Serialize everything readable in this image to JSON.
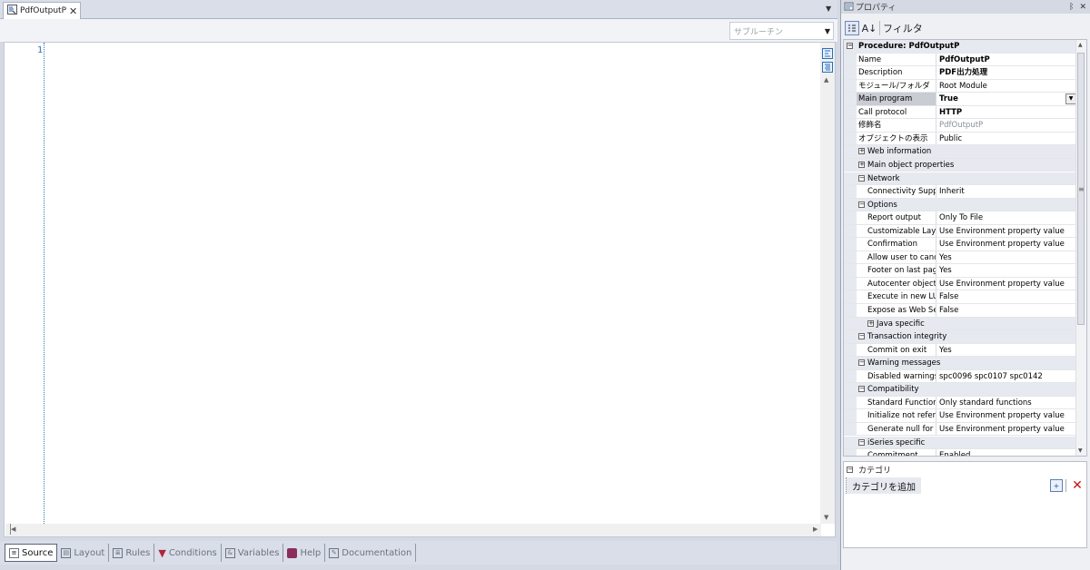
{
  "editor": {
    "tab_title": "PdfOutputP",
    "tab_close": "✕",
    "subroutine_placeholder": "サブルーチン",
    "line_numbers": [
      "1"
    ]
  },
  "part_tabs": [
    {
      "label": "Source",
      "icon": "source-icon",
      "active": true
    },
    {
      "label": "Layout",
      "icon": "layout-icon",
      "active": false
    },
    {
      "label": "Rules",
      "icon": "rules-icon",
      "active": false
    },
    {
      "label": "Conditions",
      "icon": "conditions-filter-icon",
      "active": false
    },
    {
      "label": "Variables",
      "icon": "variables-icon",
      "active": false
    },
    {
      "label": "Help",
      "icon": "help-book-icon",
      "active": false
    },
    {
      "label": "Documentation",
      "icon": "documentation-icon",
      "active": false
    }
  ],
  "properties": {
    "panel_title": "プロパティ",
    "filter_label": "フィルタ",
    "object_header": "Procedure: PdfOutputP",
    "rows": [
      {
        "kind": "prop",
        "name": "Name",
        "value": "PdfOutputP",
        "bold": true
      },
      {
        "kind": "prop",
        "name": "Description",
        "value": "PDF出力処理",
        "bold": true
      },
      {
        "kind": "prop",
        "name": "モジュール/フォルダ",
        "value": "Root Module"
      },
      {
        "kind": "prop",
        "name": "Main program",
        "value": "True",
        "bold": true,
        "selected": true,
        "dropdown": true
      },
      {
        "kind": "prop",
        "name": "Call protocol",
        "value": "HTTP",
        "bold": true
      },
      {
        "kind": "prop",
        "name": "修飾名",
        "value": "PdfOutputP",
        "gray": true
      },
      {
        "kind": "prop",
        "name": "オブジェクトの表示",
        "value": "Public"
      },
      {
        "kind": "cat",
        "name": "Web information",
        "expand": "+"
      },
      {
        "kind": "cat",
        "name": "Main object properties",
        "expand": "+"
      },
      {
        "kind": "cat",
        "name": "Network",
        "expand": "−"
      },
      {
        "kind": "sub",
        "name": "Connectivity Support",
        "value": "Inherit"
      },
      {
        "kind": "cat",
        "name": "Options",
        "expand": "−"
      },
      {
        "kind": "sub",
        "name": "Report output",
        "value": "Only To File"
      },
      {
        "kind": "sub",
        "name": "Customizable Layout",
        "value": "Use Environment property value"
      },
      {
        "kind": "sub",
        "name": "Confirmation",
        "value": "Use Environment property value"
      },
      {
        "kind": "sub",
        "name": "Allow user to cancel p",
        "value": "Yes"
      },
      {
        "kind": "sub",
        "name": "Footer on last page",
        "value": "Yes"
      },
      {
        "kind": "sub",
        "name": "Autocenter objects ir",
        "value": "Use Environment property value"
      },
      {
        "kind": "sub",
        "name": "Execute in new LUW",
        "value": "False"
      },
      {
        "kind": "sub",
        "name": "Expose as Web Servi",
        "value": "False"
      },
      {
        "kind": "subcat",
        "name": "Java specific",
        "expand": "+"
      },
      {
        "kind": "cat",
        "name": "Transaction integrity",
        "expand": "−"
      },
      {
        "kind": "sub",
        "name": "Commit on exit",
        "value": "Yes"
      },
      {
        "kind": "cat",
        "name": "Warning messages",
        "expand": "−"
      },
      {
        "kind": "sub",
        "name": "Disabled warnings",
        "value": "spc0096 spc0107 spc0142"
      },
      {
        "kind": "cat",
        "name": "Compatibility",
        "expand": "−"
      },
      {
        "kind": "sub",
        "name": "Standard Functions",
        "value": "Only standard functions"
      },
      {
        "kind": "sub",
        "name": "Initialize not referenc",
        "value": "Use Environment property value"
      },
      {
        "kind": "sub",
        "name": "Generate null for nulls",
        "value": "Use Environment property value"
      },
      {
        "kind": "cat",
        "name": "iSeries specific",
        "expand": "−"
      },
      {
        "kind": "sub",
        "name": "Commitment",
        "value": "Enabled"
      }
    ]
  },
  "categories": {
    "header": "カテゴリ",
    "add_button": "カテゴリを追加"
  },
  "colors": {
    "panel_bg": "#d4d9e3",
    "line_number": "#2b6cb0",
    "delete": "#c81414"
  }
}
